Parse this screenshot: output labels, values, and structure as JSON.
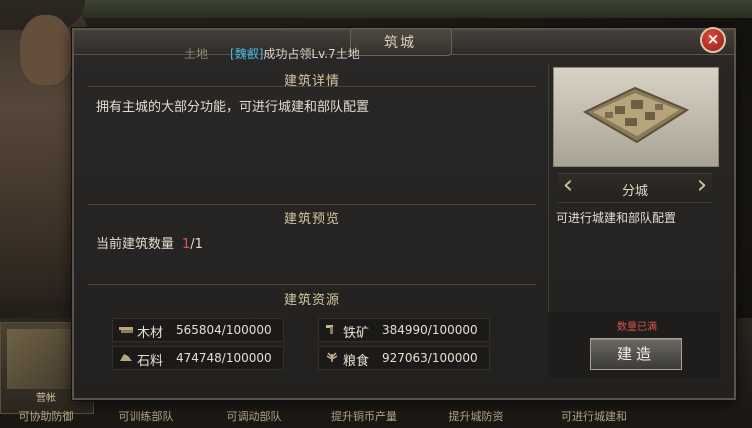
{
  "dialog": {
    "title": "筑城",
    "close_label": "×",
    "notice": {
      "prefix": "土地",
      "tag": "[魏叡]",
      "text": "成功占领Lv.7土地"
    },
    "details": {
      "heading": "建筑详情",
      "description": "拥有主城的大部分功能，可进行城建和部队配置"
    },
    "preview": {
      "heading": "建筑预览",
      "count_label": "当前建筑数量",
      "count_current": "1",
      "count_total": "/1"
    },
    "resources": {
      "heading": "建筑资源",
      "items": [
        {
          "icon": "wood-icon",
          "name": "木材",
          "value": "565804/100000"
        },
        {
          "icon": "iron-icon",
          "name": "铁矿",
          "value": "384990/100000"
        },
        {
          "icon": "stone-icon",
          "name": "石料",
          "value": "474748/100000"
        },
        {
          "icon": "grain-icon",
          "name": "粮食",
          "value": "927063/100000"
        }
      ]
    },
    "building": {
      "name": "分城",
      "description": "可进行城建和部队配置",
      "quantity_status": "数量已满",
      "build_label": "建造"
    }
  },
  "background": {
    "bottom_cards": [
      {
        "tag": "营帐",
        "label": "可协助防御"
      },
      {
        "label": "可训练部队"
      },
      {
        "label": "可调动部队"
      },
      {
        "label": "提升铜币产量"
      },
      {
        "label": "提升城防资"
      },
      {
        "label": "可进行城建和"
      }
    ]
  },
  "colors": {
    "accent_red": "#d45a4e",
    "tag_blue": "#49b7e6",
    "heading_gold": "#d4c6a2"
  }
}
